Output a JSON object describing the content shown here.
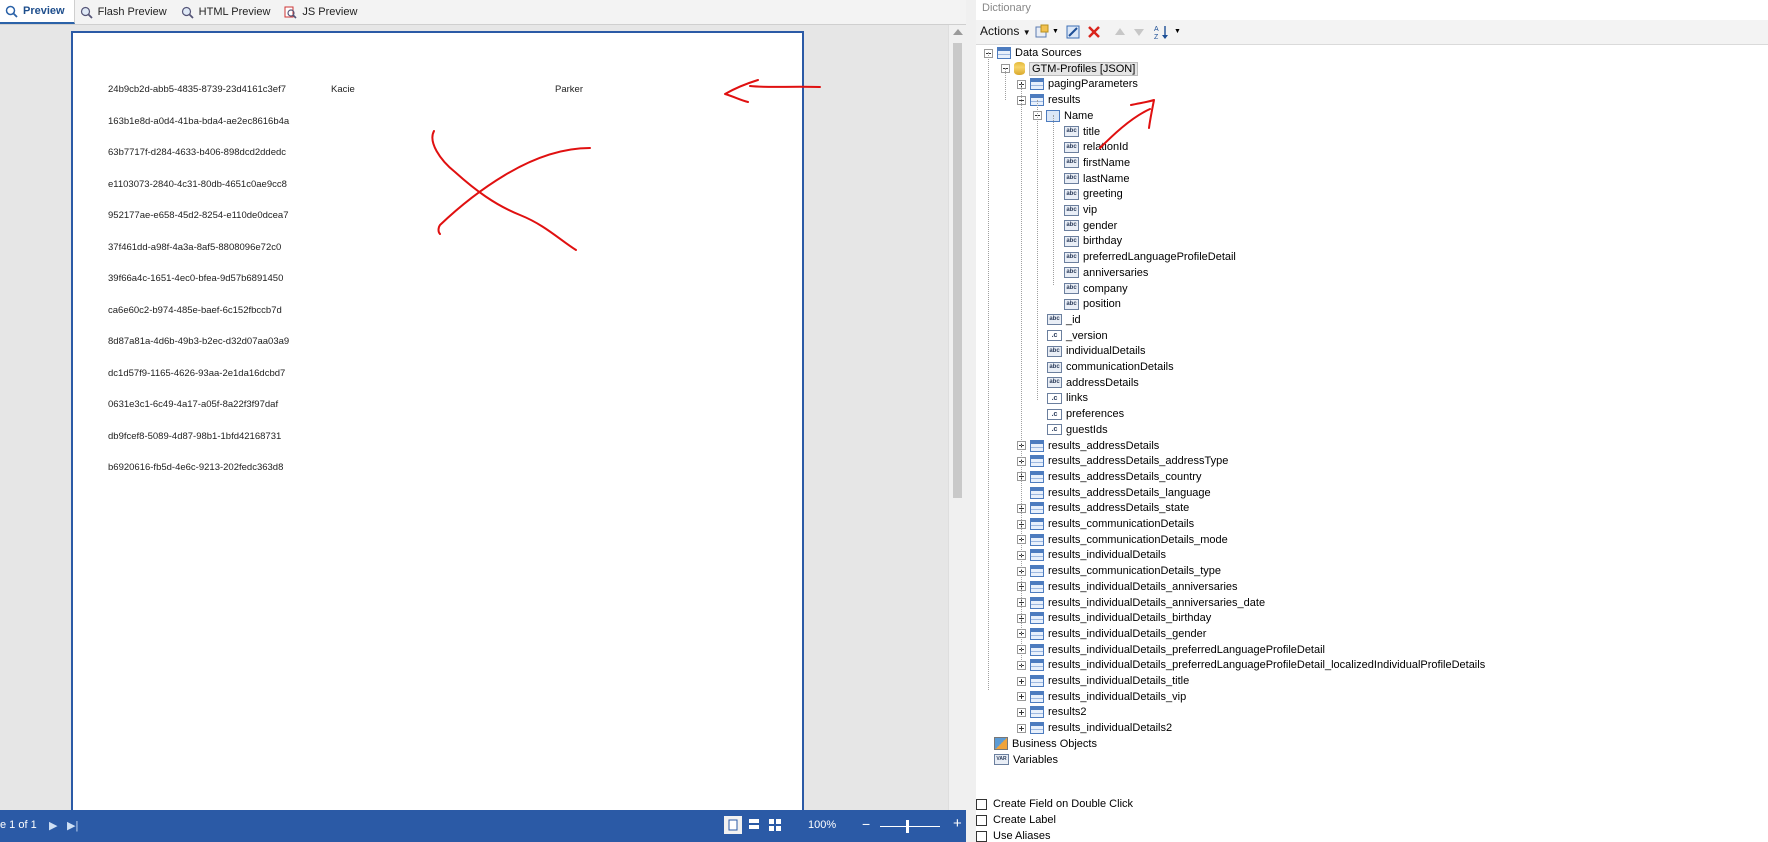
{
  "preview_tabs": [
    {
      "label": "Preview",
      "icon": "preview-icon",
      "active": true
    },
    {
      "label": "Flash Preview",
      "icon": "flash-preview-icon",
      "active": false
    },
    {
      "label": "HTML Preview",
      "icon": "html-preview-icon",
      "active": false
    },
    {
      "label": "JS Preview",
      "icon": "js-preview-icon",
      "active": false
    }
  ],
  "report": {
    "rows": [
      {
        "id": "24b9cb2d-abb5-4835-8739-23d4161c3ef7",
        "first": "Kacie",
        "last": "Parker"
      },
      {
        "id": "163b1e8d-a0d4-41ba-bda4-ae2ec8616b4a",
        "first": "",
        "last": ""
      },
      {
        "id": "63b7717f-d284-4633-b406-898dcd2ddedc",
        "first": "",
        "last": ""
      },
      {
        "id": "e1103073-2840-4c31-80db-4651c0ae9cc8",
        "first": "",
        "last": ""
      },
      {
        "id": "952177ae-e658-45d2-8254-e110de0dcea7",
        "first": "",
        "last": ""
      },
      {
        "id": "37f461dd-a98f-4a3a-8af5-8808096e72c0",
        "first": "",
        "last": ""
      },
      {
        "id": "39f66a4c-1651-4ec0-bfea-9d57b6891450",
        "first": "",
        "last": ""
      },
      {
        "id": "ca6e60c2-b974-485e-baef-6c152fbccb7d",
        "first": "",
        "last": ""
      },
      {
        "id": "8d87a81a-4d6b-49b3-b2ec-d32d07aa03a9",
        "first": "",
        "last": ""
      },
      {
        "id": "dc1d57f9-1165-4626-93aa-2e1da16dcbd7",
        "first": "",
        "last": ""
      },
      {
        "id": "0631e3c1-6c49-4a17-a05f-8a22f3f97daf",
        "first": "",
        "last": ""
      },
      {
        "id": "db9fcef8-5089-4d87-98b1-1bfd42168731",
        "first": "",
        "last": ""
      },
      {
        "id": "b6920616-fb5d-4e6c-9213-202fedc363d8",
        "first": "",
        "last": ""
      }
    ]
  },
  "statusbar": {
    "page_info": "e 1 of 1",
    "zoom": "100%",
    "minus": "−",
    "plus": "+"
  },
  "dictionary": {
    "title": "Dictionary",
    "actions_label": "Actions",
    "tree": [
      {
        "label": "Data Sources",
        "icon": "table",
        "exp": "minus"
      },
      {
        "label": "GTM-Profiles [JSON]",
        "icon": "db",
        "exp": "minus",
        "selected": true
      },
      {
        "label": "pagingParameters",
        "icon": "table",
        "exp": "plus"
      },
      {
        "label": "results",
        "icon": "table",
        "exp": "minus"
      },
      {
        "label": "Name",
        "icon": "name",
        "exp": "minus"
      },
      {
        "label": "title",
        "icon": "abc"
      },
      {
        "label": "relationId",
        "icon": "abc"
      },
      {
        "label": "firstName",
        "icon": "abc"
      },
      {
        "label": "lastName",
        "icon": "abc"
      },
      {
        "label": "greeting",
        "icon": "abc"
      },
      {
        "label": "vip",
        "icon": "abc"
      },
      {
        "label": "gender",
        "icon": "abc"
      },
      {
        "label": "birthday",
        "icon": "abc"
      },
      {
        "label": "preferredLanguageProfileDetail",
        "icon": "abc"
      },
      {
        "label": "anniversaries",
        "icon": "abc"
      },
      {
        "label": "company",
        "icon": "abc"
      },
      {
        "label": "position",
        "icon": "abc"
      },
      {
        "label": "_id",
        "icon": "abc"
      },
      {
        "label": "_version",
        "icon": "obj"
      },
      {
        "label": "individualDetails",
        "icon": "abc"
      },
      {
        "label": "communicationDetails",
        "icon": "abc"
      },
      {
        "label": "addressDetails",
        "icon": "abc"
      },
      {
        "label": "links",
        "icon": "obj"
      },
      {
        "label": "preferences",
        "icon": "obj"
      },
      {
        "label": "guestIds",
        "icon": "obj"
      },
      {
        "label": "results_addressDetails",
        "icon": "table",
        "exp": "plus"
      },
      {
        "label": "results_addressDetails_addressType",
        "icon": "table",
        "exp": "plus"
      },
      {
        "label": "results_addressDetails_country",
        "icon": "table",
        "exp": "plus"
      },
      {
        "label": "results_addressDetails_language",
        "icon": "table"
      },
      {
        "label": "results_addressDetails_state",
        "icon": "table",
        "exp": "plus"
      },
      {
        "label": "results_communicationDetails",
        "icon": "table",
        "exp": "plus"
      },
      {
        "label": "results_communicationDetails_mode",
        "icon": "table",
        "exp": "plus"
      },
      {
        "label": "results_individualDetails",
        "icon": "table",
        "exp": "plus"
      },
      {
        "label": "results_communicationDetails_type",
        "icon": "table",
        "exp": "plus"
      },
      {
        "label": "results_individualDetails_anniversaries",
        "icon": "table",
        "exp": "plus"
      },
      {
        "label": "results_individualDetails_anniversaries_date",
        "icon": "table",
        "exp": "plus"
      },
      {
        "label": "results_individualDetails_birthday",
        "icon": "table",
        "exp": "plus"
      },
      {
        "label": "results_individualDetails_gender",
        "icon": "table",
        "exp": "plus"
      },
      {
        "label": "results_individualDetails_preferredLanguageProfileDetail",
        "icon": "table",
        "exp": "plus"
      },
      {
        "label": "results_individualDetails_preferredLanguageProfileDetail_localizedIndividualProfileDetails",
        "icon": "table",
        "exp": "plus"
      },
      {
        "label": "results_individualDetails_title",
        "icon": "table",
        "exp": "plus"
      },
      {
        "label": "results_individualDetails_vip",
        "icon": "table",
        "exp": "plus"
      },
      {
        "label": "results2",
        "icon": "table",
        "exp": "plus"
      },
      {
        "label": "results_individualDetails2",
        "icon": "table",
        "exp": "plus"
      },
      {
        "label": "Business Objects",
        "icon": "bo"
      },
      {
        "label": "Variables",
        "icon": "var"
      }
    ],
    "options": [
      {
        "label": "Create Field on Double Click"
      },
      {
        "label": "Create Label"
      },
      {
        "label": "Use Aliases"
      }
    ]
  },
  "colors": {
    "accent": "#2b5aa6",
    "annotation": "#e01010"
  }
}
